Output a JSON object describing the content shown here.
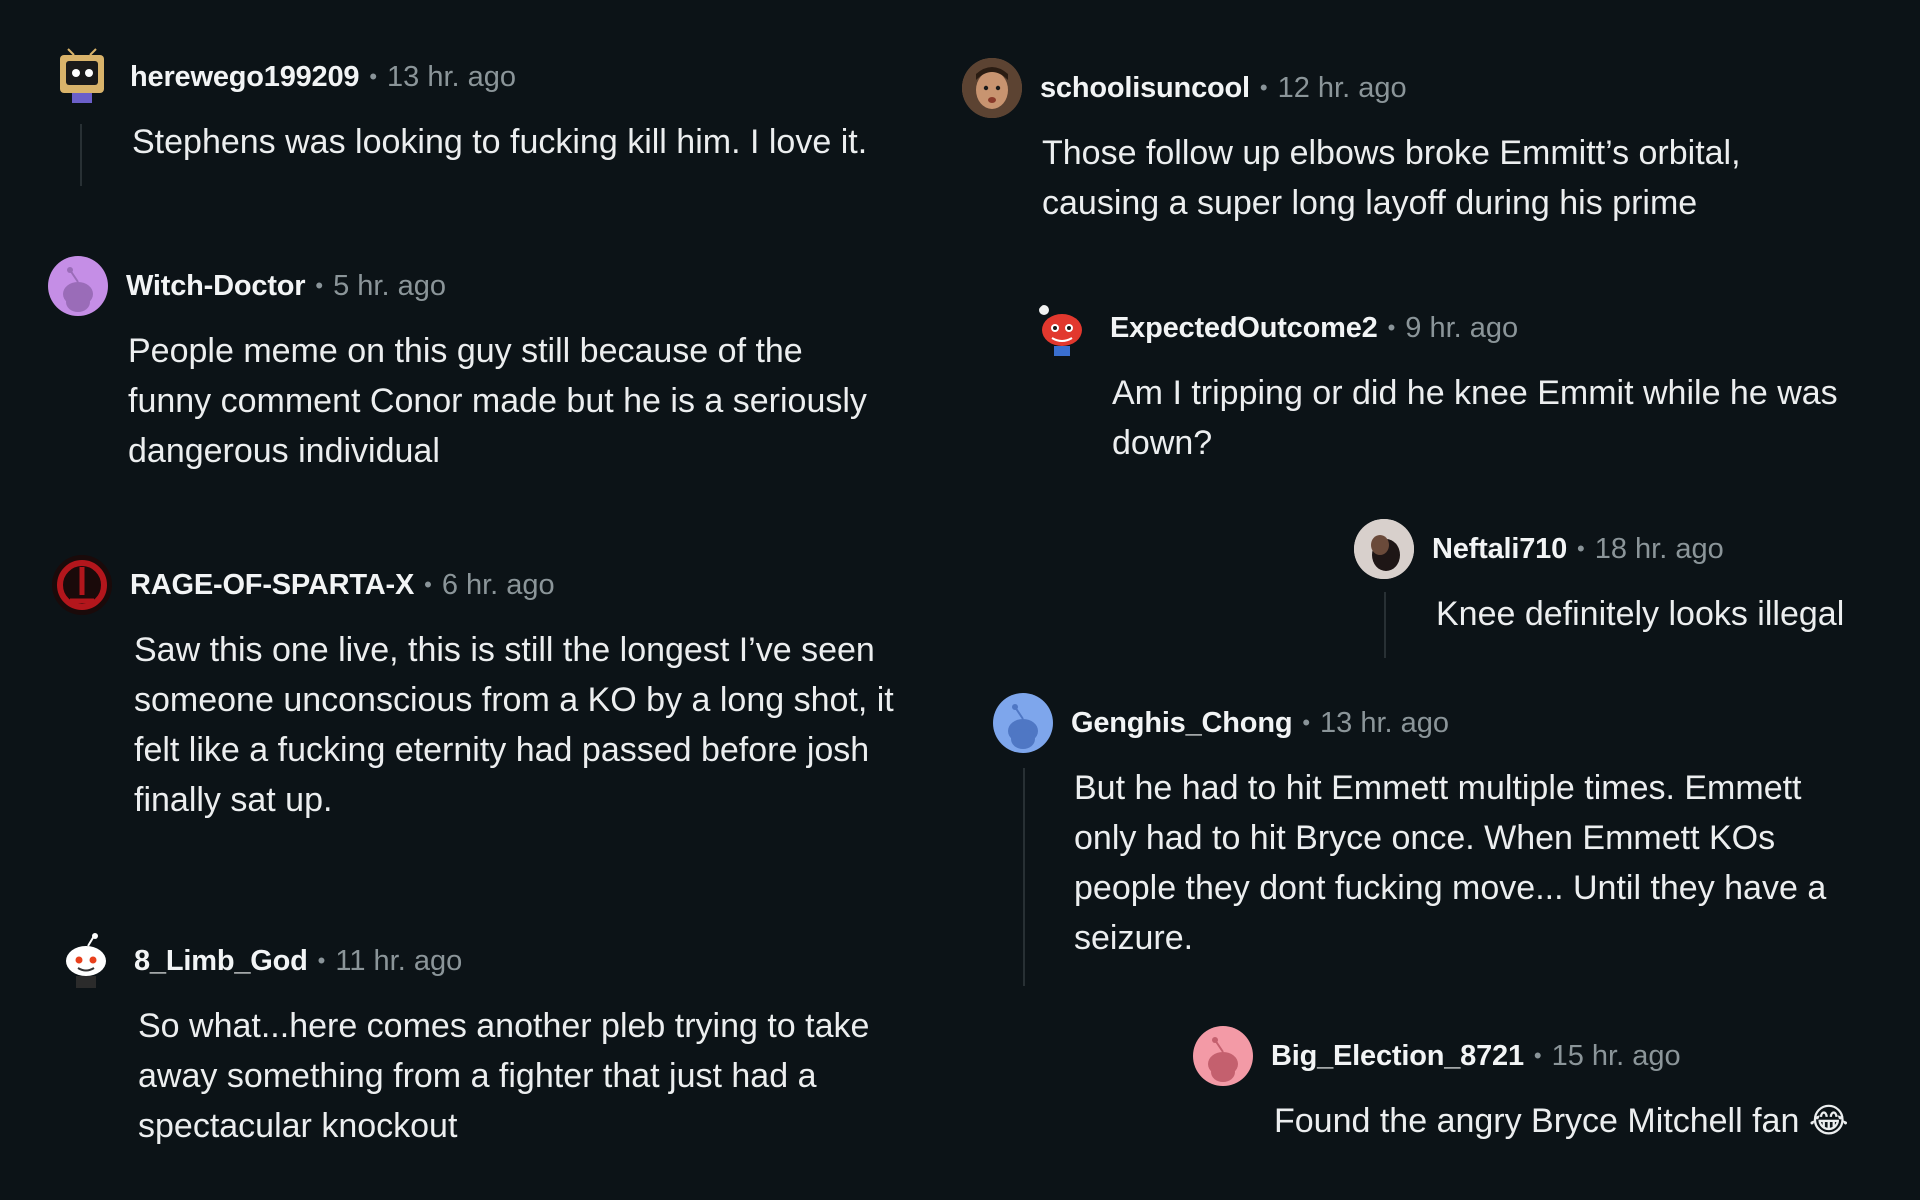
{
  "comments": [
    {
      "username": "herewego199209",
      "time": "13 hr. ago",
      "lines": [
        "Stephens was looking to fucking kill him. I love it."
      ],
      "avatar_icon": "tv-robot-avatar-icon",
      "avatar_color": "#d9b36a"
    },
    {
      "username": "Witch-Doctor",
      "time": "5 hr. ago",
      "lines": [
        "People meme on this guy still because of the",
        "funny comment Conor made but he is a seriously",
        "dangerous individual"
      ],
      "avatar_icon": "snoo-default-avatar-icon",
      "avatar_color": "#c58ee6"
    },
    {
      "username": "RAGE-OF-SPARTA-X",
      "time": "6 hr. ago",
      "lines": [
        "Saw this one live, this is still the longest I’ve seen",
        "someone unconscious from a KO by a long shot, it",
        "felt like a fucking eternity had passed before josh",
        "finally sat up."
      ],
      "avatar_icon": "omega-symbol-avatar-icon",
      "avatar_color": "#b3161c"
    },
    {
      "username": "8_Limb_God",
      "time": "11 hr. ago",
      "lines": [
        "So what...here comes another pleb trying to take",
        "away something from a fighter that just had a",
        "spectacular knockout"
      ],
      "avatar_icon": "snoo-character-avatar-icon",
      "avatar_color": "#ffffff"
    },
    {
      "username": "schoolisuncool",
      "time": "12 hr. ago",
      "lines": [
        "Those follow up elbows broke Emmitt’s orbital,",
        "causing a super long layoff during his prime"
      ],
      "avatar_icon": "photo-face-avatar-icon",
      "avatar_color": "#7a5a44"
    },
    {
      "username": "ExpectedOutcome2",
      "time": "9 hr. ago",
      "lines": [
        "Am I tripping or did he knee Emmit while he was",
        "down?"
      ],
      "avatar_icon": "red-snoo-avatar-icon",
      "avatar_color": "#e2382e"
    },
    {
      "username": "Neftali710",
      "time": "18 hr. ago",
      "lines": [
        "Knee definitely looks illegal"
      ],
      "avatar_icon": "photo-avatar-icon",
      "avatar_color": "#3b2a2a"
    },
    {
      "username": "Genghis_Chong",
      "time": "13 hr. ago",
      "lines": [
        "But he had to hit Emmett multiple times. Emmett",
        "only had to hit Bryce once. When Emmett KOs",
        "people they dont fucking move... Until they have a",
        "seizure."
      ],
      "avatar_icon": "snoo-default-avatar-icon",
      "avatar_color": "#7ea6ec"
    },
    {
      "username": "Big_Election_8721",
      "time": "15 hr. ago",
      "lines": [
        "Found the angry Bryce Mitchell fan 😂"
      ],
      "avatar_icon": "snoo-default-avatar-icon",
      "avatar_color": "#f39aa6"
    }
  ]
}
